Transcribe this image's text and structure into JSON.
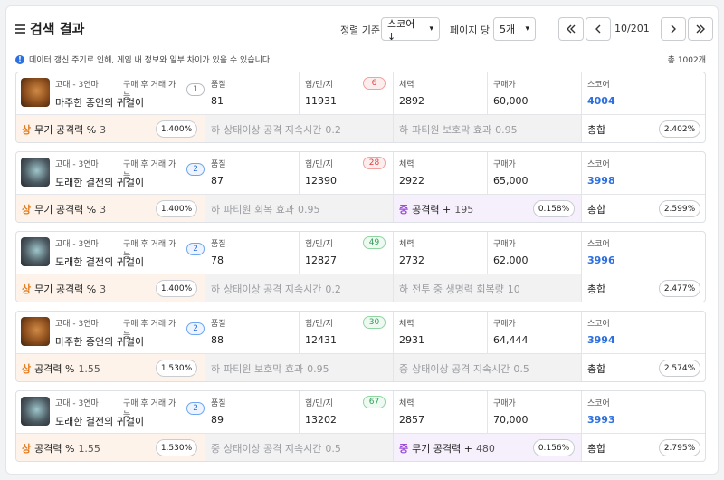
{
  "header": {
    "title": "검색 결과",
    "sort_label": "정렬 기준",
    "sort_value": "스코어 ↓",
    "per_page_label": "페이지 당",
    "per_page_value": "5개",
    "page_indicator": "10/201"
  },
  "notice": "데이터 갱신 주기로 인해, 게임 내 정보와 일부 차이가 있을 수 있습니다.",
  "total": "총 1002개",
  "labels": {
    "quality": "품질",
    "stats": "힘/민/지",
    "vitality": "체력",
    "price": "구매가",
    "score": "스코어",
    "sum": "총합"
  },
  "items": [
    {
      "grade": "고대 - 3연마",
      "trade_label": "구매 후 거래 가능",
      "trade_count": "1",
      "trade_style": "gray",
      "name": "마주한 종언의 귀걸이",
      "icon": "earring-orange-icon",
      "quality": "81",
      "stats": "11931",
      "stats_badge": "6",
      "stats_badge_color": "red",
      "vitality": "2892",
      "price": "60,000",
      "score": "4004",
      "effects": [
        {
          "tier": "상",
          "name": "무기 공격력 %",
          "value": "3",
          "pct": "1.400%",
          "style": "orange"
        },
        {
          "tier": "하",
          "name": "상태이상 공격 지속시간",
          "value": "0.2",
          "style": "gray"
        },
        {
          "tier": "하",
          "name": "파티원 보호막 효과",
          "value": "0.95",
          "style": "gray"
        }
      ],
      "sum_pct": "2.402%"
    },
    {
      "grade": "고대 - 3연마",
      "trade_label": "구매 후 거래 가능",
      "trade_count": "2",
      "trade_style": "blue",
      "name": "도래한 결전의 귀걸이",
      "icon": "earring-gray-icon",
      "quality": "87",
      "stats": "12390",
      "stats_badge": "28",
      "stats_badge_color": "red",
      "vitality": "2922",
      "price": "65,000",
      "score": "3998",
      "effects": [
        {
          "tier": "상",
          "name": "무기 공격력 %",
          "value": "3",
          "pct": "1.400%",
          "style": "orange"
        },
        {
          "tier": "하",
          "name": "파티원 회복 효과",
          "value": "0.95",
          "style": "gray"
        },
        {
          "tier": "중",
          "name": "공격력 +",
          "value": "195",
          "pct": "0.158%",
          "style": "purple"
        }
      ],
      "sum_pct": "2.599%"
    },
    {
      "grade": "고대 - 3연마",
      "trade_label": "구매 후 거래 가능",
      "trade_count": "2",
      "trade_style": "blue",
      "name": "도래한 결전의 귀걸이",
      "icon": "earring-gray-icon",
      "quality": "78",
      "stats": "12827",
      "stats_badge": "49",
      "stats_badge_color": "green",
      "vitality": "2732",
      "price": "62,000",
      "score": "3996",
      "effects": [
        {
          "tier": "상",
          "name": "무기 공격력 %",
          "value": "3",
          "pct": "1.400%",
          "style": "orange"
        },
        {
          "tier": "하",
          "name": "상태이상 공격 지속시간",
          "value": "0.2",
          "style": "gray"
        },
        {
          "tier": "하",
          "name": "전투 중 생명력 회복량",
          "value": "10",
          "style": "gray"
        }
      ],
      "sum_pct": "2.477%"
    },
    {
      "grade": "고대 - 3연마",
      "trade_label": "구매 후 거래 가능",
      "trade_count": "2",
      "trade_style": "blue",
      "name": "마주한 종언의 귀걸이",
      "icon": "earring-orange-icon",
      "quality": "88",
      "stats": "12431",
      "stats_badge": "30",
      "stats_badge_color": "green",
      "vitality": "2931",
      "price": "64,444",
      "score": "3994",
      "effects": [
        {
          "tier": "상",
          "name": "공격력 %",
          "value": "1.55",
          "pct": "1.530%",
          "style": "orange"
        },
        {
          "tier": "하",
          "name": "파티원 보호막 효과",
          "value": "0.95",
          "style": "gray"
        },
        {
          "tier": "중",
          "name": "상태이상 공격 지속시간",
          "value": "0.5",
          "style": "gray"
        }
      ],
      "sum_pct": "2.574%"
    },
    {
      "grade": "고대 - 3연마",
      "trade_label": "구매 후 거래 가능",
      "trade_count": "2",
      "trade_style": "blue",
      "name": "도래한 결전의 귀걸이",
      "icon": "earring-gray-icon",
      "quality": "89",
      "stats": "13202",
      "stats_badge": "67",
      "stats_badge_color": "green",
      "vitality": "2857",
      "price": "70,000",
      "score": "3993",
      "effects": [
        {
          "tier": "상",
          "name": "공격력 %",
          "value": "1.55",
          "pct": "1.530%",
          "style": "orange"
        },
        {
          "tier": "중",
          "name": "상태이상 공격 지속시간",
          "value": "0.5",
          "style": "gray"
        },
        {
          "tier": "중",
          "name": "무기 공격력 +",
          "value": "480",
          "pct": "0.156%",
          "style": "purple"
        }
      ],
      "sum_pct": "2.795%"
    }
  ]
}
